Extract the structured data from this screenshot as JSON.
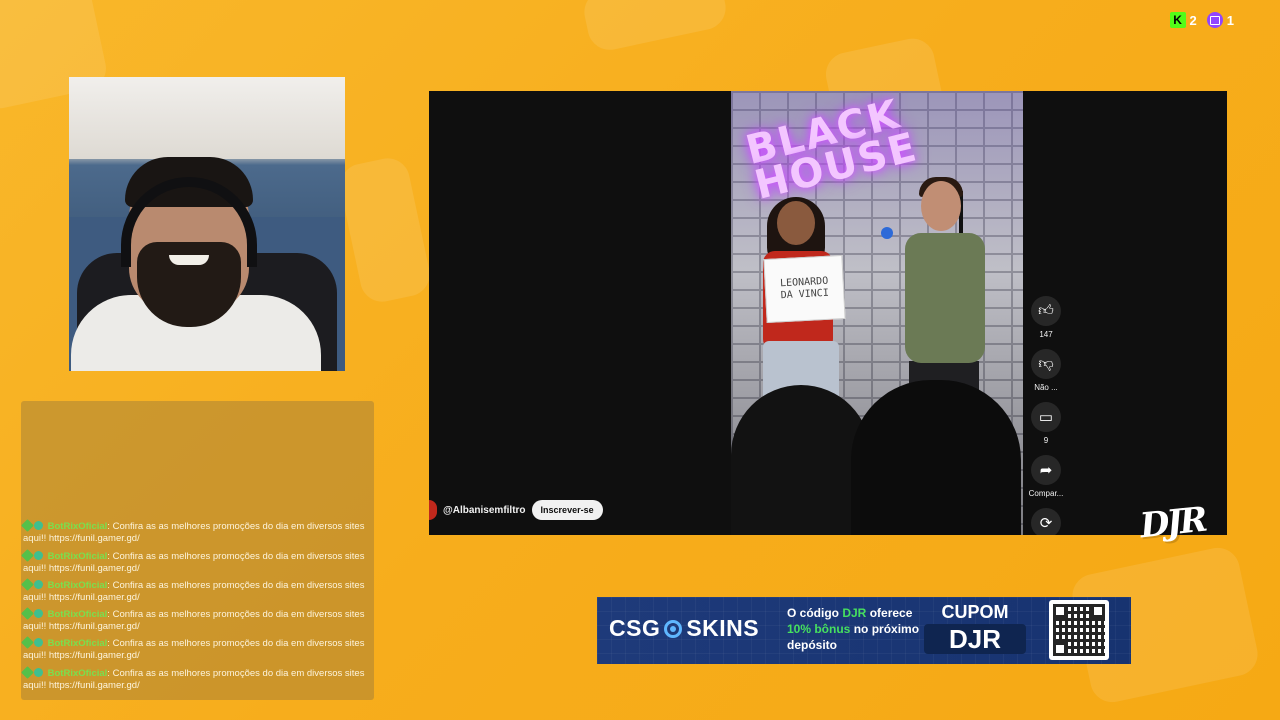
{
  "viewers": {
    "kick_count": "2",
    "twitch_count": "1",
    "kick_icon": "kick-icon",
    "twitch_icon": "twitch-icon"
  },
  "chat": {
    "messages": [
      {
        "user": "BotRixOficial",
        "text": "Confira as as melhores promoções do dia em diversos sites aqui!! https://funil.gamer.gd/"
      },
      {
        "user": "BotRixOficial",
        "text": "Confira as as melhores promoções do dia em diversos sites aqui!! https://funil.gamer.gd/"
      },
      {
        "user": "BotRixOficial",
        "text": "Confira as as melhores promoções do dia em diversos sites aqui!! https://funil.gamer.gd/"
      },
      {
        "user": "BotRixOficial",
        "text": "Confira as as melhores promoções do dia em diversos sites aqui!! https://funil.gamer.gd/"
      },
      {
        "user": "BotRixOficial",
        "text": "Confira as as melhores promoções do dia em diversos sites aqui!! https://funil.gamer.gd/"
      },
      {
        "user": "BotRixOficial",
        "text": "Confira as as melhores promoções do dia em diversos sites aqui!! https://funil.gamer.gd/"
      }
    ]
  },
  "video": {
    "neon_line1": "BLACK",
    "neon_line2": "HOUSE",
    "sign_line1": "LEONARDO",
    "sign_line2": "DA VINCI",
    "channel_name": "@Albanisemfiltro",
    "subscribe_label": "Inscrever-se",
    "like_count": "147",
    "dislike_label": "Não ...",
    "comment_count": "9",
    "share_label": "Compar..."
  },
  "overlay_logo": "DJR",
  "ad": {
    "brand_left": "CSG",
    "brand_right": "SKINS",
    "copy_prefix": "O código ",
    "copy_code": "DJR",
    "copy_mid": " oferece",
    "copy_bonus": "10% bônus",
    "copy_line2_rest": " no próximo",
    "copy_line3": "depósito",
    "cupom_label": "CUPOM",
    "cupom_code": "DJR"
  },
  "colors": {
    "background": "#f7ad1c",
    "chat_username": "#78e04f",
    "ad_background": "#1e3a7a",
    "ad_highlight": "#46e05f"
  }
}
